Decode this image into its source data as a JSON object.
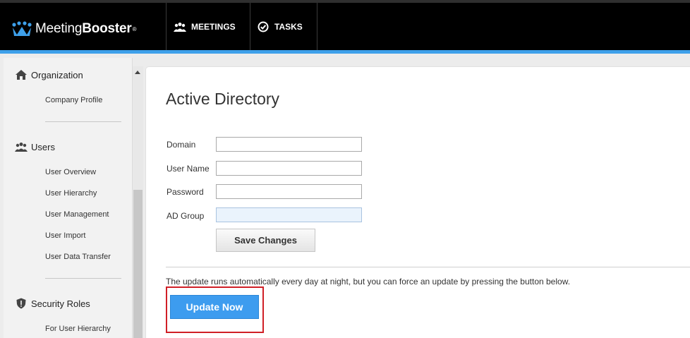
{
  "app": {
    "logo_text_light": "Meeting",
    "logo_text_bold": "Booster",
    "logo_mark": "®"
  },
  "nav": {
    "meetings_label": "MEETINGS",
    "tasks_label": "TASKS"
  },
  "sidebar": {
    "sections": [
      {
        "title": "Organization",
        "icon": "home-icon",
        "items": [
          "Company Profile"
        ]
      },
      {
        "title": "Users",
        "icon": "users-icon",
        "items": [
          "User Overview",
          "User Hierarchy",
          "User Management",
          "User Import",
          "User Data Transfer"
        ]
      },
      {
        "title": "Security Roles",
        "icon": "shield-icon",
        "items": [
          "For User Hierarchy"
        ]
      }
    ]
  },
  "main": {
    "title": "Active Directory",
    "fields": {
      "domain_label": "Domain",
      "domain_value": "",
      "username_label": "User Name",
      "username_value": "",
      "password_label": "Password",
      "password_value": "",
      "adgroup_label": "AD Group",
      "adgroup_value": ""
    },
    "save_label": "Save Changes",
    "note": "The update runs automatically every day at night, but you can force an update by pressing the button below.",
    "update_label": "Update Now"
  },
  "colors": {
    "accent": "#3ea0ea",
    "primary_button": "#3d9cef",
    "highlight": "#d01f26"
  }
}
